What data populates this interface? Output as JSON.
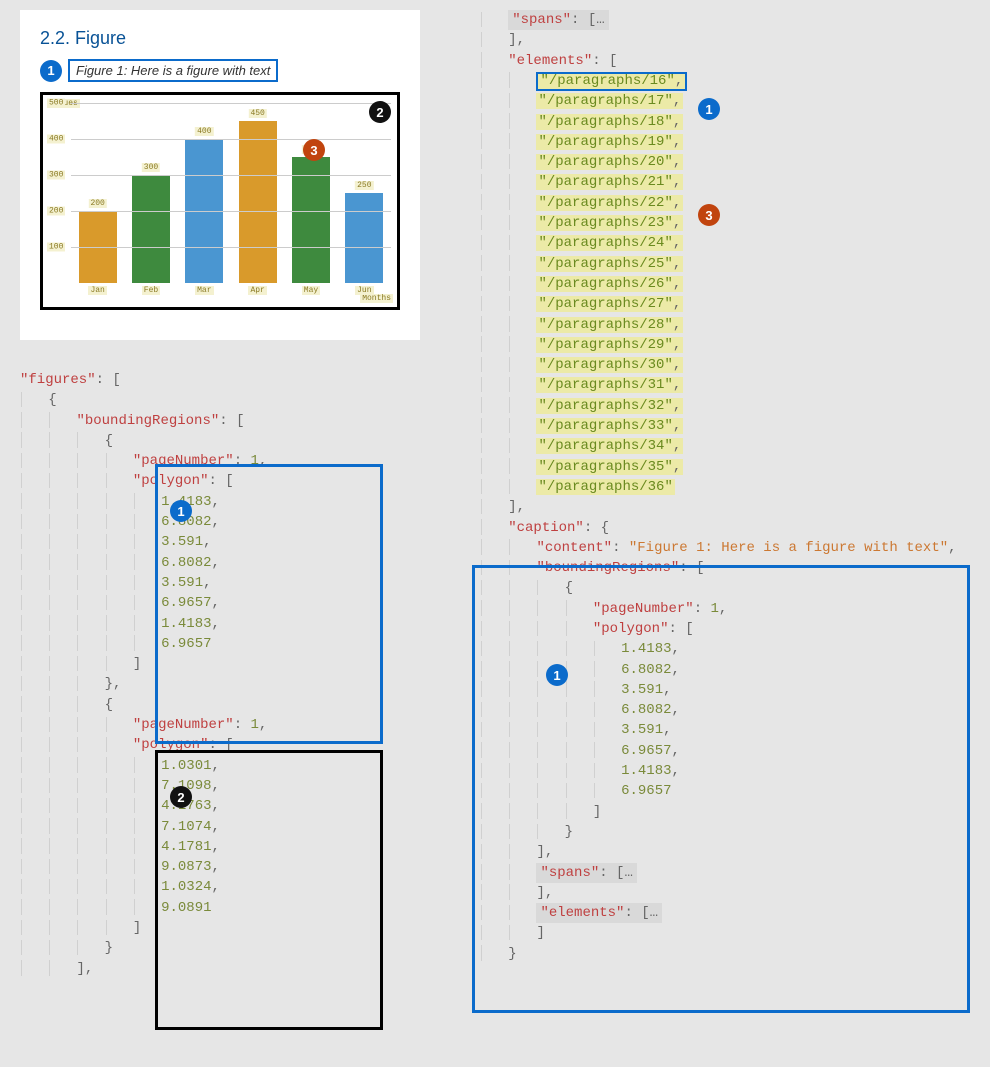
{
  "preview": {
    "heading": "2.2. Figure",
    "caption": "Figure 1: Here is a figure with text"
  },
  "badges": {
    "b1": "1",
    "b2": "2",
    "b3": "3"
  },
  "chart_data": {
    "type": "bar",
    "title": "",
    "xlabel": "Months",
    "ylabel": "Values",
    "categories": [
      "Jan",
      "Feb",
      "Mar",
      "Apr",
      "May",
      "Jun"
    ],
    "values": [
      200,
      300,
      400,
      450,
      350,
      250
    ],
    "colors": [
      "orange",
      "green",
      "blue",
      "orange",
      "green",
      "blue"
    ],
    "ylim": [
      0,
      500
    ],
    "y_ticks": [
      100,
      200,
      300,
      400,
      500
    ]
  },
  "json_left": {
    "root_key": "figures",
    "br_key": "boundingRegions",
    "region1": {
      "pageNumberKey": "pageNumber",
      "pageNumber": "1",
      "polygonKey": "polygon",
      "vals": [
        "1.4183",
        "6.8082",
        "3.591",
        "6.8082",
        "3.591",
        "6.9657",
        "1.4183",
        "6.9657"
      ]
    },
    "region2": {
      "pageNumberKey": "pageNumber",
      "pageNumber": "1",
      "polygonKey": "polygon",
      "vals": [
        "1.0301",
        "7.1098",
        "4.1763",
        "7.1074",
        "4.1781",
        "9.0873",
        "1.0324",
        "9.0891"
      ]
    }
  },
  "json_right": {
    "spans_key": "spans",
    "elements_key": "elements",
    "elements": [
      "/paragraphs/16",
      "/paragraphs/17",
      "/paragraphs/18",
      "/paragraphs/19",
      "/paragraphs/20",
      "/paragraphs/21",
      "/paragraphs/22",
      "/paragraphs/23",
      "/paragraphs/24",
      "/paragraphs/25",
      "/paragraphs/26",
      "/paragraphs/27",
      "/paragraphs/28",
      "/paragraphs/29",
      "/paragraphs/30",
      "/paragraphs/31",
      "/paragraphs/32",
      "/paragraphs/33",
      "/paragraphs/34",
      "/paragraphs/35",
      "/paragraphs/36"
    ],
    "caption": {
      "caption_key": "caption",
      "content_key": "content",
      "content_val": "Figure 1: Here is a figure with text",
      "br_key": "boundingRegions",
      "pageNumberKey": "pageNumber",
      "pageNumber": "1",
      "polygonKey": "polygon",
      "vals": [
        "1.4183",
        "6.8082",
        "3.591",
        "6.8082",
        "3.591",
        "6.9657",
        "1.4183",
        "6.9657"
      ],
      "spans_key": "spans",
      "elements_key": "elements"
    }
  },
  "ellipsis": "…"
}
